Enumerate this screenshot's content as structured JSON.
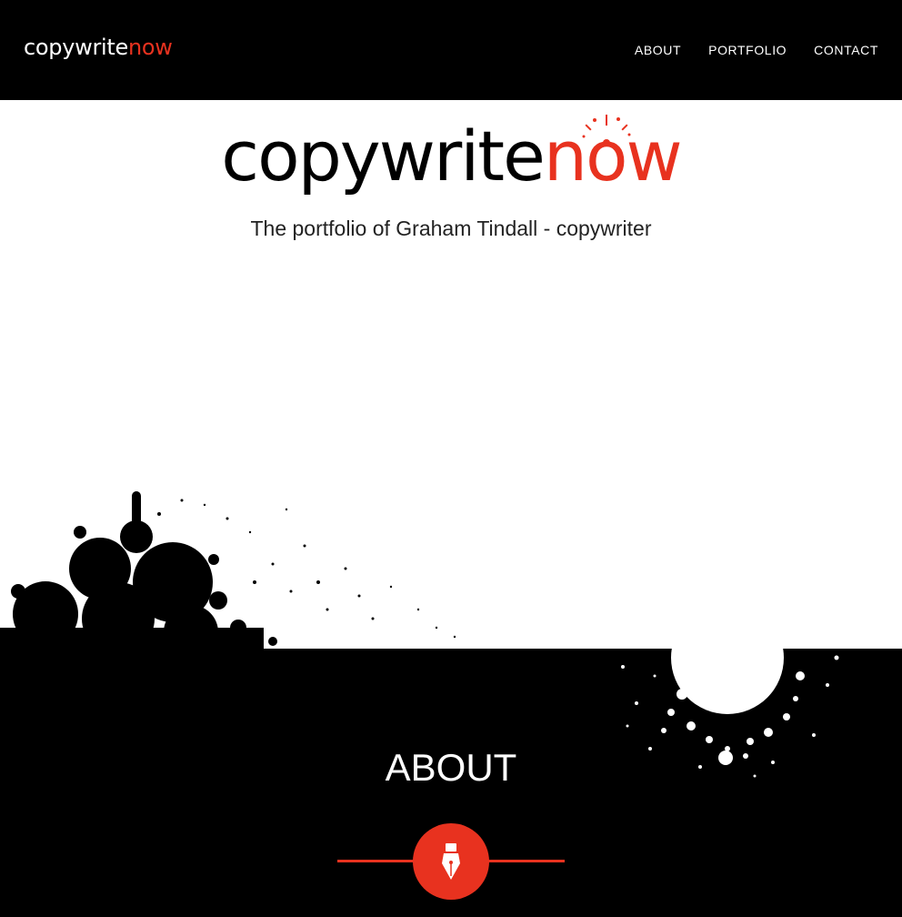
{
  "brand": {
    "prefix": "copywrite",
    "accent": "now"
  },
  "nav": {
    "items": [
      {
        "label": "ABOUT"
      },
      {
        "label": "PORTFOLIO"
      },
      {
        "label": "CONTACT"
      }
    ]
  },
  "hero": {
    "logo_prefix": "copywrite",
    "logo_accent_n": "n",
    "logo_accent_o": "o",
    "logo_accent_w": "w",
    "tagline": "The portfolio of Graham Tindall - copywriter"
  },
  "about": {
    "title": "ABOUT",
    "icon": "fountain-pen-icon"
  },
  "colors": {
    "accent": "#e8321f",
    "dark": "#000000",
    "light": "#ffffff"
  }
}
